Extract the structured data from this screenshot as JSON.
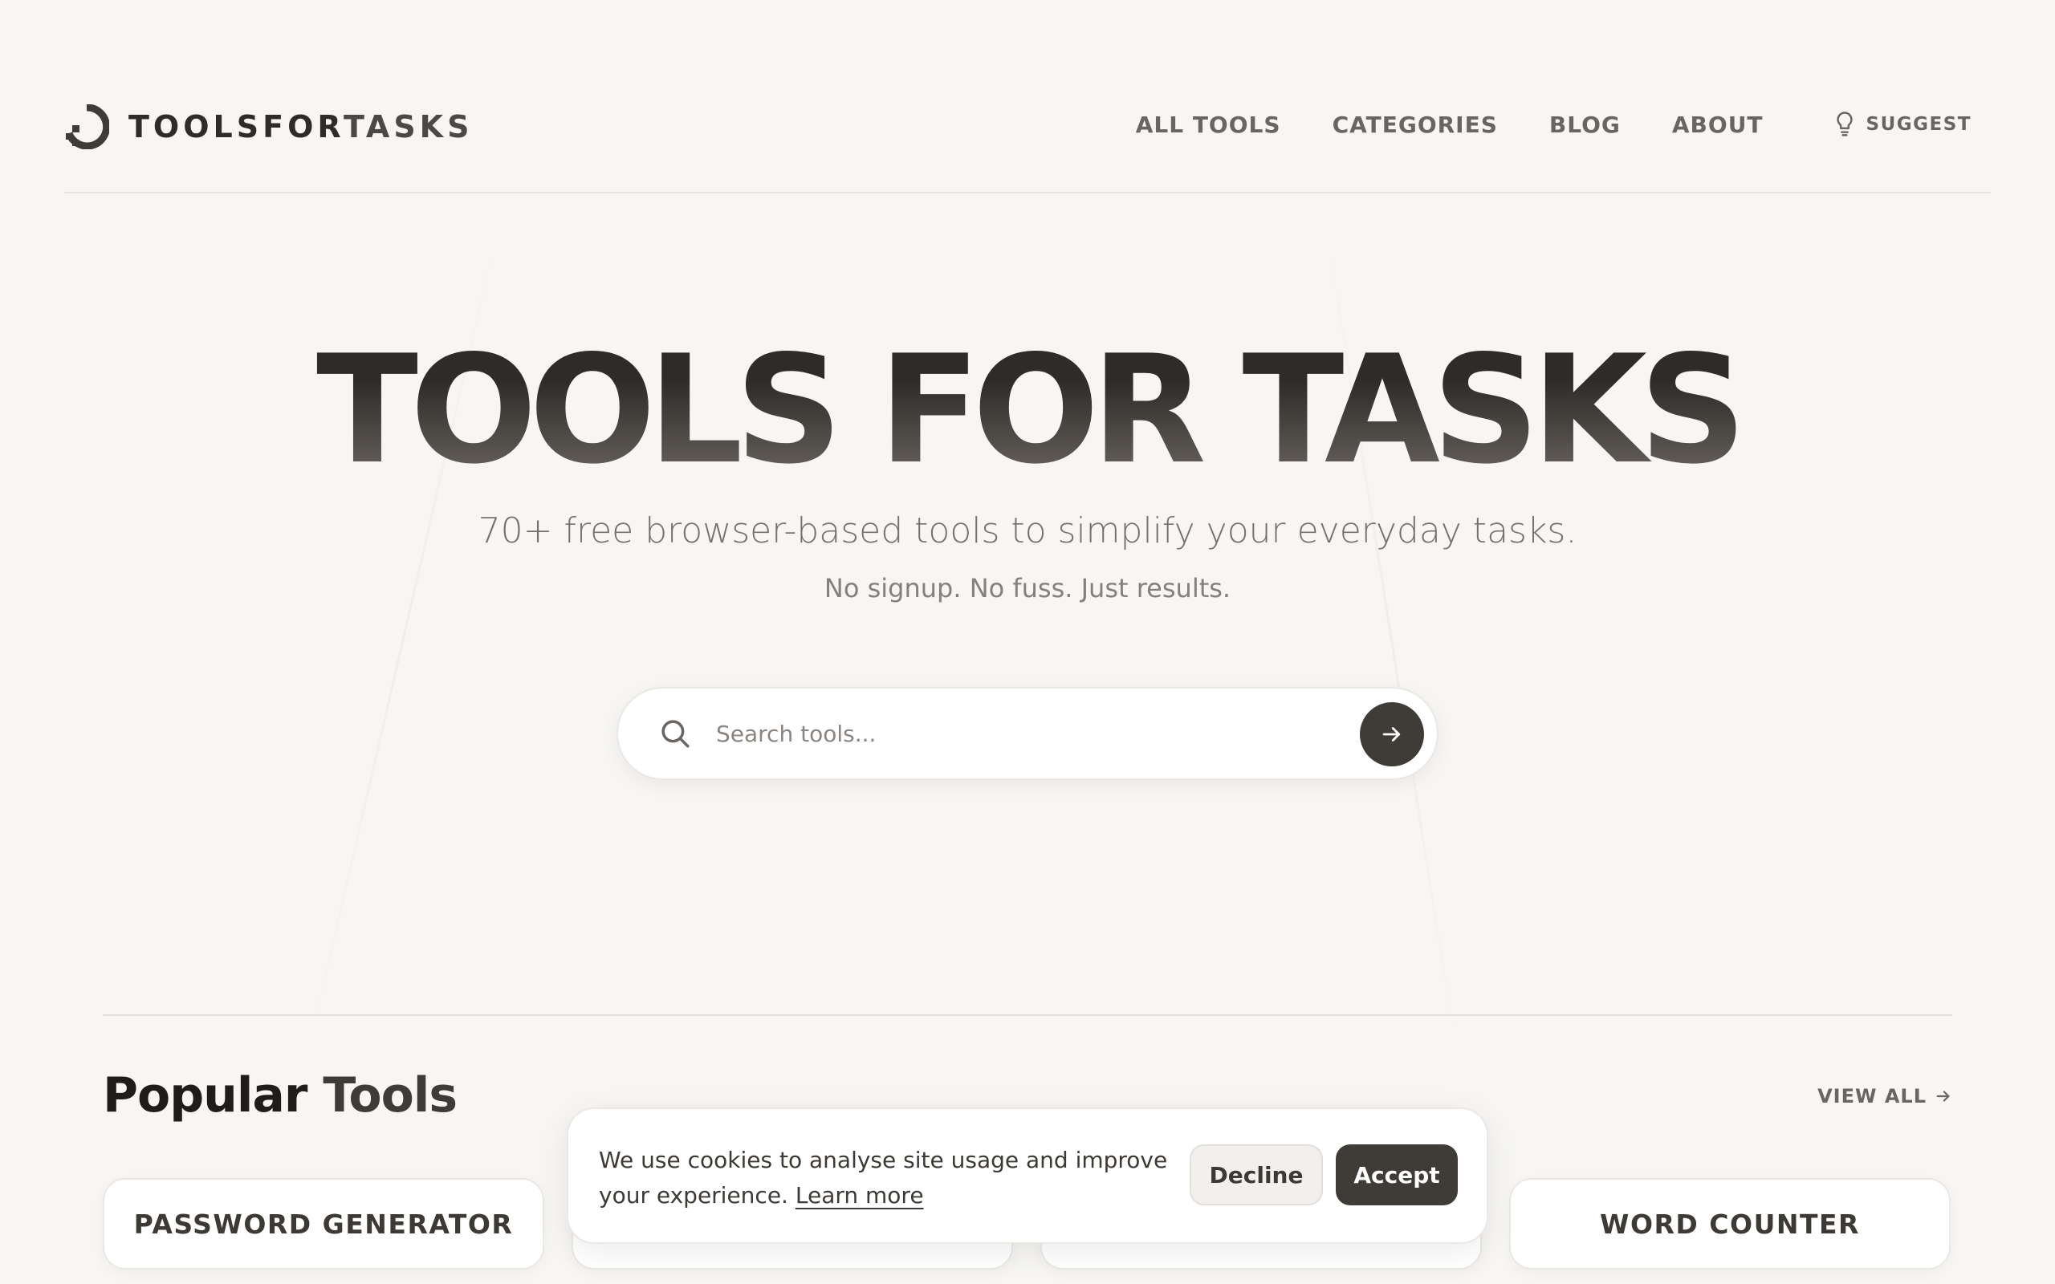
{
  "brand": {
    "name_bold": "TOOLSFOR",
    "name_light": "TASKS",
    "logo_icon": "logo-mark-icon"
  },
  "nav": {
    "items": [
      {
        "label": "ALL TOOLS"
      },
      {
        "label": "CATEGORIES"
      },
      {
        "label": "BLOG"
      },
      {
        "label": "ABOUT"
      }
    ],
    "suggest": {
      "label": "SUGGEST",
      "icon": "lightbulb-icon"
    }
  },
  "hero": {
    "title": "TOOLS FOR TASKS",
    "subtitle": "70+ free browser-based tools to simplify your everyday tasks.",
    "tagline": "No signup. No fuss. Just results."
  },
  "search": {
    "placeholder": "Search tools...",
    "value": "",
    "icon": "search-icon",
    "submit_icon": "arrow-right-icon"
  },
  "popular": {
    "title_main": "Popular",
    "title_accent": "Tools",
    "view_all": "VIEW ALL",
    "tools": [
      {
        "label": "PASSWORD GENERATOR"
      },
      {
        "label": ""
      },
      {
        "label": ""
      },
      {
        "label": "WORD COUNTER"
      }
    ]
  },
  "cookie": {
    "text": "We use cookies to analyse site usage and improve your experience.",
    "link": "Learn more",
    "decline": "Decline",
    "accept": "Accept"
  },
  "colors": {
    "background": "#f7f6f4",
    "primary_dark": "#3f3b37",
    "muted_text": "#6b6561"
  }
}
